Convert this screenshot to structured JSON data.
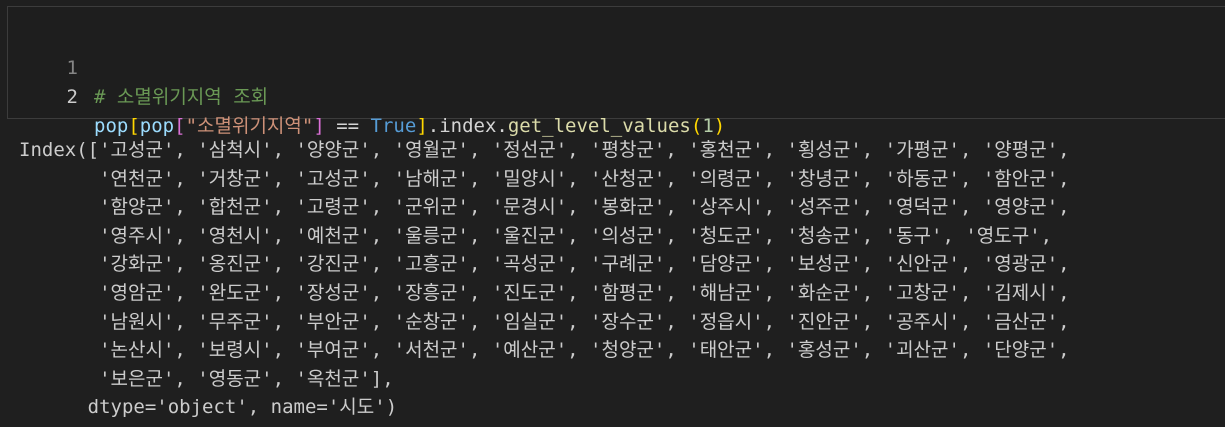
{
  "cell": {
    "lines": [
      {
        "number": "1"
      },
      {
        "number": "2"
      }
    ],
    "line1": {
      "comment": "# 소멸위기지역 조회"
    },
    "line2": {
      "t1": "pop",
      "t2": "[",
      "t3": "pop",
      "t4": "[",
      "t5": "\"소멸위기지역\"",
      "t6": "]",
      "t7": " == ",
      "t8": "True",
      "t9": "]",
      "t10": ".index.",
      "t11": "get_level_values",
      "t12": "(",
      "t13": "1",
      "t14": ")"
    }
  },
  "output": {
    "lines": [
      "Index(['고성군', '삼척시', '양양군', '영월군', '정선군', '평창군', '홍천군', '횡성군', '가평군', '양평군',",
      "       '연천군', '거창군', '고성군', '남해군', '밀양시', '산청군', '의령군', '창녕군', '하동군', '함안군',",
      "       '함양군', '합천군', '고령군', '군위군', '문경시', '봉화군', '상주시', '성주군', '영덕군', '영양군',",
      "       '영주시', '영천시', '예천군', '울릉군', '울진군', '의성군', '청도군', '청송군', '동구', '영도구',",
      "       '강화군', '옹진군', '강진군', '고흥군', '곡성군', '구례군', '담양군', '보성군', '신안군', '영광군',",
      "       '영암군', '완도군', '장성군', '장흥군', '진도군', '함평군', '해남군', '화순군', '고창군', '김제시',",
      "       '남원시', '무주군', '부안군', '순창군', '임실군', '장수군', '정읍시', '진안군', '공주시', '금산군',",
      "       '논산시', '보령시', '부여군', '서천군', '예산군', '청양군', '태안군', '홍성군', '괴산군', '단양군',",
      "       '보은군', '영동군', '옥천군'],",
      "      dtype='object', name='시도')"
    ]
  }
}
